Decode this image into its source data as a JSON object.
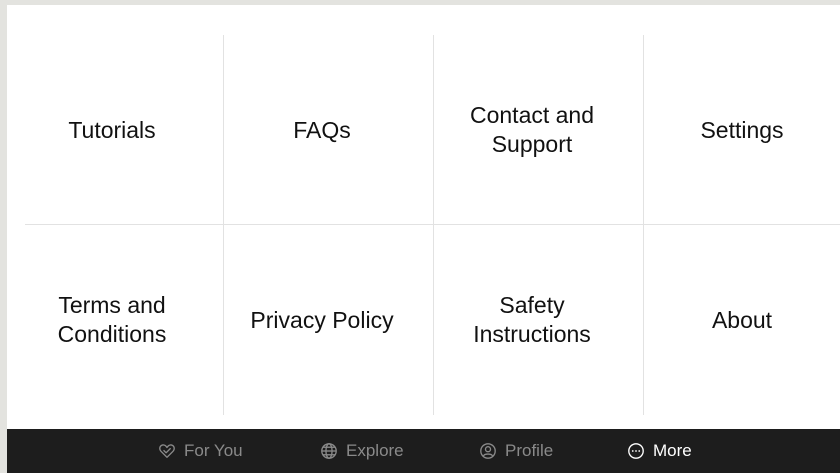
{
  "menu": {
    "row1": [
      {
        "label": "Tutorials"
      },
      {
        "label": "FAQs"
      },
      {
        "label": "Contact and\nSupport"
      },
      {
        "label": "Settings"
      }
    ],
    "row2": [
      {
        "label": "Terms and\nConditions"
      },
      {
        "label": "Privacy Policy"
      },
      {
        "label": "Safety\nInstructions"
      },
      {
        "label": "About"
      }
    ]
  },
  "bottom_nav": {
    "items": [
      {
        "label": "For You",
        "icon": "heart-check-icon",
        "active": false
      },
      {
        "label": "Explore",
        "icon": "globe-icon",
        "active": false
      },
      {
        "label": "Profile",
        "icon": "user-circle-icon",
        "active": false
      },
      {
        "label": "More",
        "icon": "more-dots-icon",
        "active": true
      }
    ]
  },
  "colors": {
    "background": "#e3e3df",
    "panel": "#ffffff",
    "nav_bar": "#1d1d1d",
    "nav_inactive": "#8a8a8a",
    "nav_active": "#ffffff",
    "divider": "#e2e2e2"
  }
}
